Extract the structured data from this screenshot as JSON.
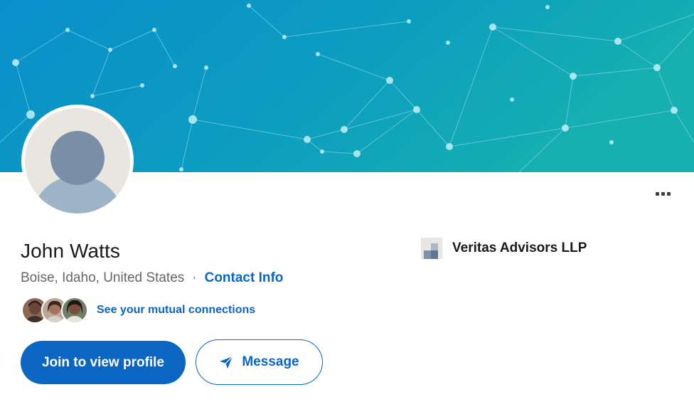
{
  "profile": {
    "name": "John Watts",
    "location": "Boise, Idaho, United States",
    "separator": "·",
    "contact_info_label": "Contact Info",
    "mutual_connections_label": "See your mutual connections",
    "mutual_avatar_count": 3
  },
  "actions": {
    "join_label": "Join to view profile",
    "message_label": "Message",
    "more_icon": "more-horizontal-icon",
    "message_icon": "send-icon"
  },
  "company": {
    "name": "Veritas Advisors LLP",
    "logo_icon": "company-logo-icon"
  },
  "colors": {
    "primary_blue": "#0a66c2",
    "banner_left": "#0b8fc9",
    "banner_right": "#11a9b6",
    "text_primary": "#191919",
    "text_secondary": "#666666"
  }
}
